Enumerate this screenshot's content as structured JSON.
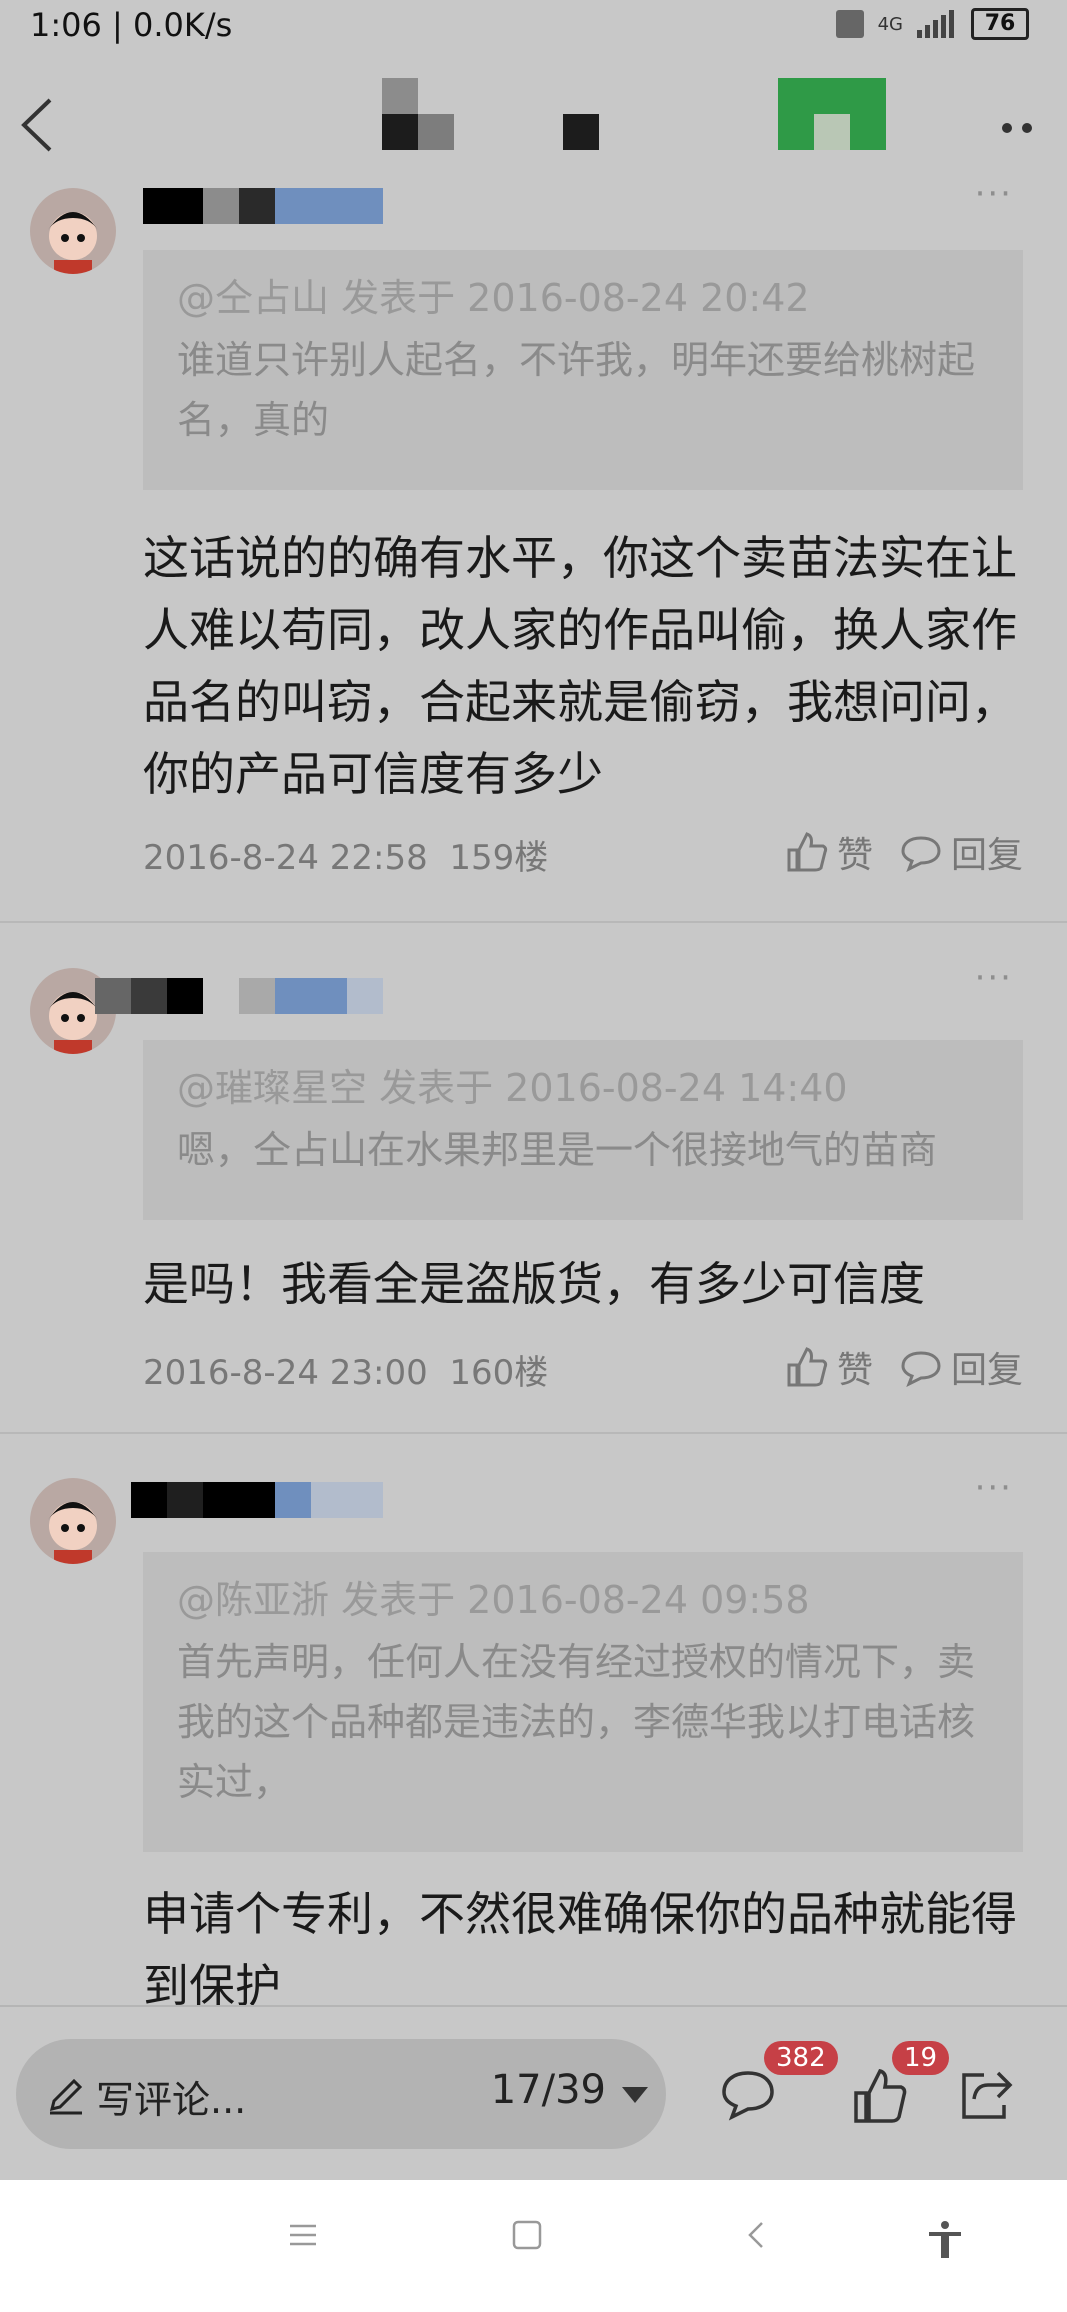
{
  "status_bar": {
    "time_speed": "1:06 | 0.0K/s",
    "network": "4G",
    "battery": "76"
  },
  "comments": [
    {
      "quote_meta": "@仝占山 发表于 2016-08-24 20:42",
      "quote_text": "谁道只许别人起名，不许我，明年还要给桃树起名，真的",
      "body": "这话说的的确有水平，你这个卖苗法实在让人难以苟同，改人家的作品叫偷，换人家作品名的叫窃，合起来就是偷窃，我想问问，你的产品可信度有多少",
      "datetime": "2016-8-24 22:58",
      "floor": "159楼",
      "like_label": "赞",
      "reply_label": "回复"
    },
    {
      "quote_meta": "@璀璨星空 发表于 2016-08-24 14:40",
      "quote_text": "嗯，仝占山在水果邦里是一个很接地气的苗商",
      "body": "是吗！我看全是盗版货，有多少可信度",
      "datetime": "2016-8-24 23:00",
      "floor": "160楼",
      "like_label": "赞",
      "reply_label": "回复"
    },
    {
      "quote_meta": "@陈亚浙 发表于 2016-08-24 09:58",
      "quote_text": "首先声明，任何人在没有经过授权的情况下，卖我的这个品种都是违法的，李德华我以打电话核实过，",
      "body": "申请个专利，不然很难确保你的品种就能得到保护"
    }
  ],
  "bottom_bar": {
    "write_placeholder": "写评论...",
    "page_indicator": "17/39",
    "comment_count": "382",
    "like_count": "19"
  },
  "icons": [
    "back-icon",
    "more-icon",
    "thumb-up-icon",
    "comment-bubble-icon",
    "pencil-icon",
    "share-icon",
    "menu-icon",
    "home-icon",
    "back-nav-icon",
    "accessibility-icon"
  ],
  "colors": {
    "badge": "#c64046",
    "background": "#c8c8c8",
    "quote_bg": "#bdbdbd"
  }
}
